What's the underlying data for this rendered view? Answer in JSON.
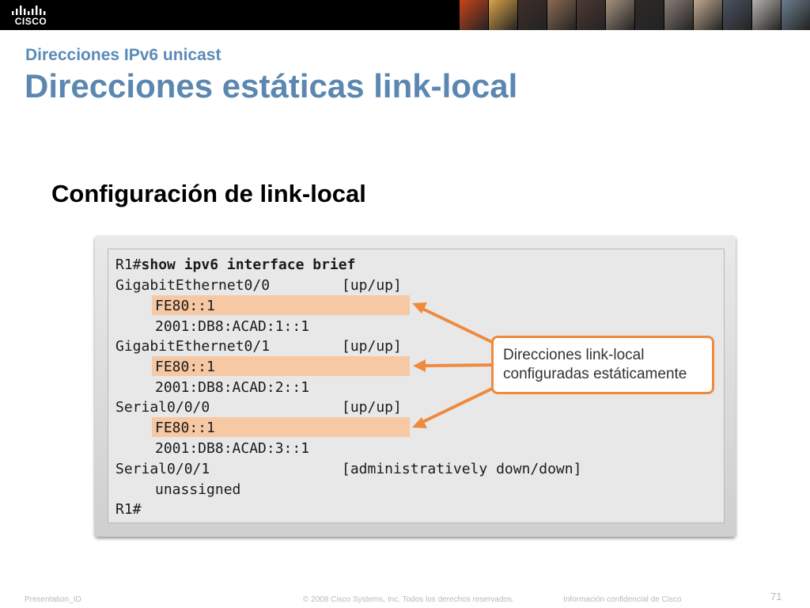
{
  "banner": {
    "logo_text": "CISCO",
    "photo_colors": [
      "#c8441b",
      "#d9a34a",
      "#3e2f2a",
      "#8c6b52",
      "#4d3a34",
      "#a5917f",
      "#2e2a29",
      "#8a7d76",
      "#c0a98f",
      "#4b5463",
      "#b5b1ad",
      "#6c7d8f"
    ]
  },
  "slide": {
    "subtitle": "Direcciones IPv6 unicast",
    "title": "Direcciones estáticas link-local",
    "section_heading": "Configuración de link-local"
  },
  "terminal": {
    "prompt": "R1#",
    "command": "show ipv6 interface brief",
    "interfaces": [
      {
        "name": "GigabitEthernet0/0",
        "status": "[up/up]",
        "link_local": "FE80::1",
        "global": "2001:DB8:ACAD:1::1"
      },
      {
        "name": "GigabitEthernet0/1",
        "status": "[up/up]",
        "link_local": "FE80::1",
        "global": "2001:DB8:ACAD:2::1"
      },
      {
        "name": "Serial0/0/0",
        "status": "[up/up]",
        "link_local": "FE80::1",
        "global": "2001:DB8:ACAD:3::1"
      },
      {
        "name": "Serial0/0/1",
        "status": "[administratively down/down]",
        "address": "unassigned"
      }
    ],
    "final_prompt": "R1#",
    "highlight_color": "#f6c8a4"
  },
  "callout": {
    "line1": "Direcciones link-local",
    "line2": "configuradas estáticamente",
    "accent_color": "#ef8a3d"
  },
  "footer": {
    "presentation_id": "Presentation_ID",
    "copyright": "© 2008 Cisco Systems, Inc. Todos los derechos reservados.",
    "confidential": "Información confidencial de Cisco",
    "page_number": "71"
  }
}
